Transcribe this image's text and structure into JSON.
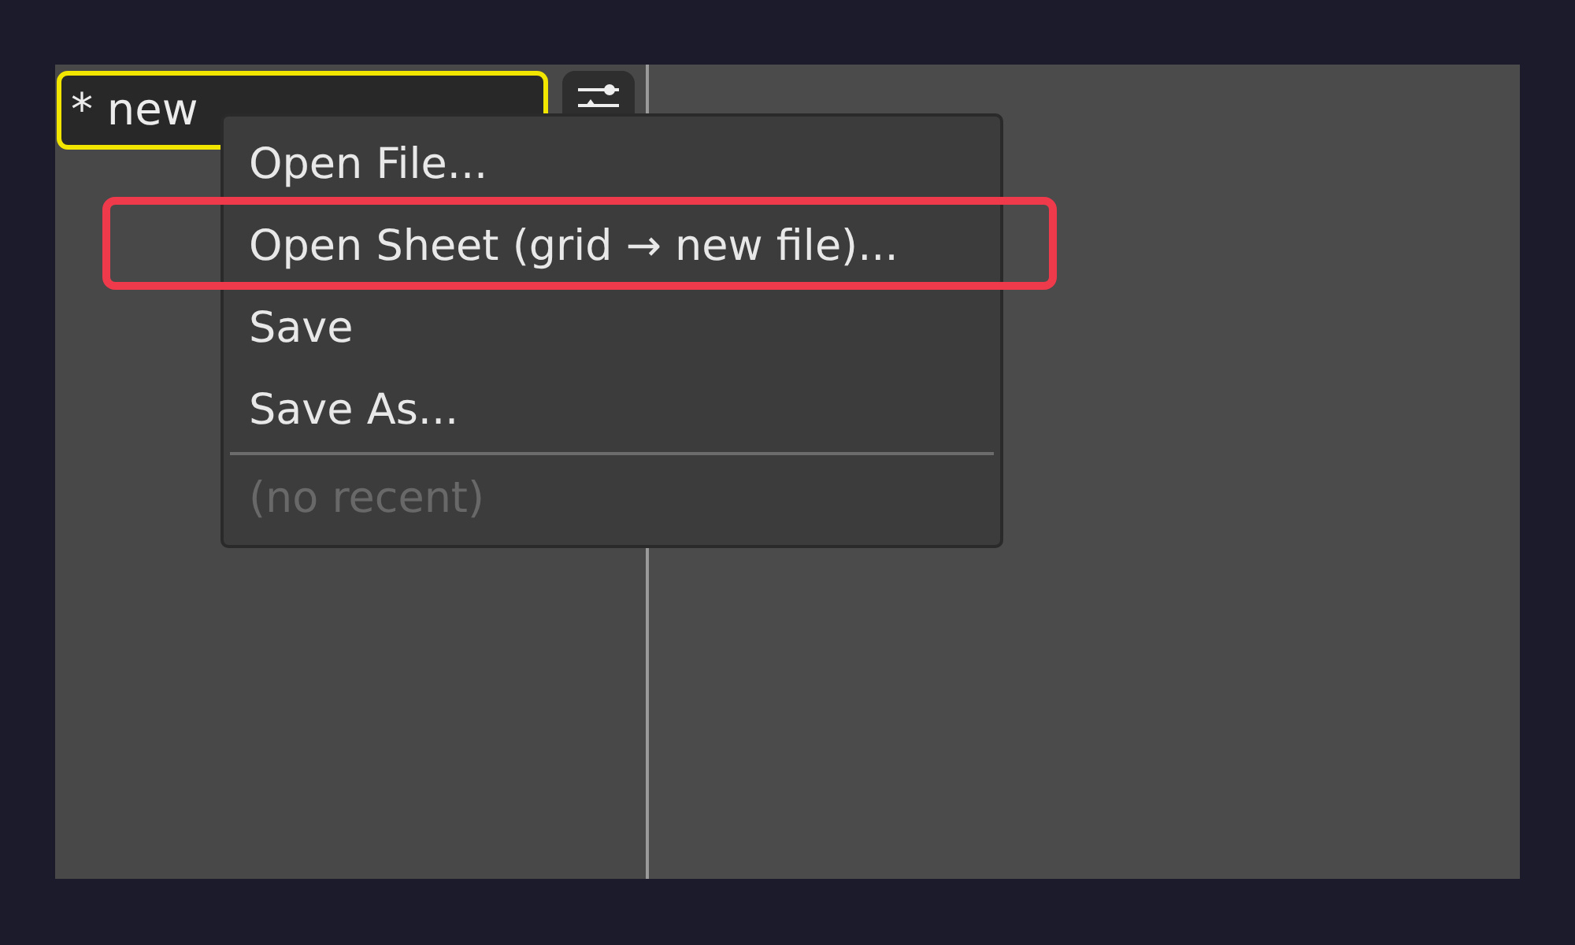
{
  "tabs": [
    {
      "label": "* new",
      "selected": true
    }
  ],
  "file_menu": {
    "items": [
      {
        "kind": "item",
        "label": "Open File...",
        "disabled": false,
        "highlighted": false
      },
      {
        "kind": "item",
        "label": "Open Sheet (grid → new file)...",
        "disabled": false,
        "highlighted": true
      },
      {
        "kind": "item",
        "label": "Save",
        "disabled": false,
        "highlighted": false
      },
      {
        "kind": "item",
        "label": "Save As...",
        "disabled": false,
        "highlighted": false
      },
      {
        "kind": "separator"
      },
      {
        "kind": "item",
        "label": "(no recent)",
        "disabled": true,
        "highlighted": false
      }
    ]
  }
}
